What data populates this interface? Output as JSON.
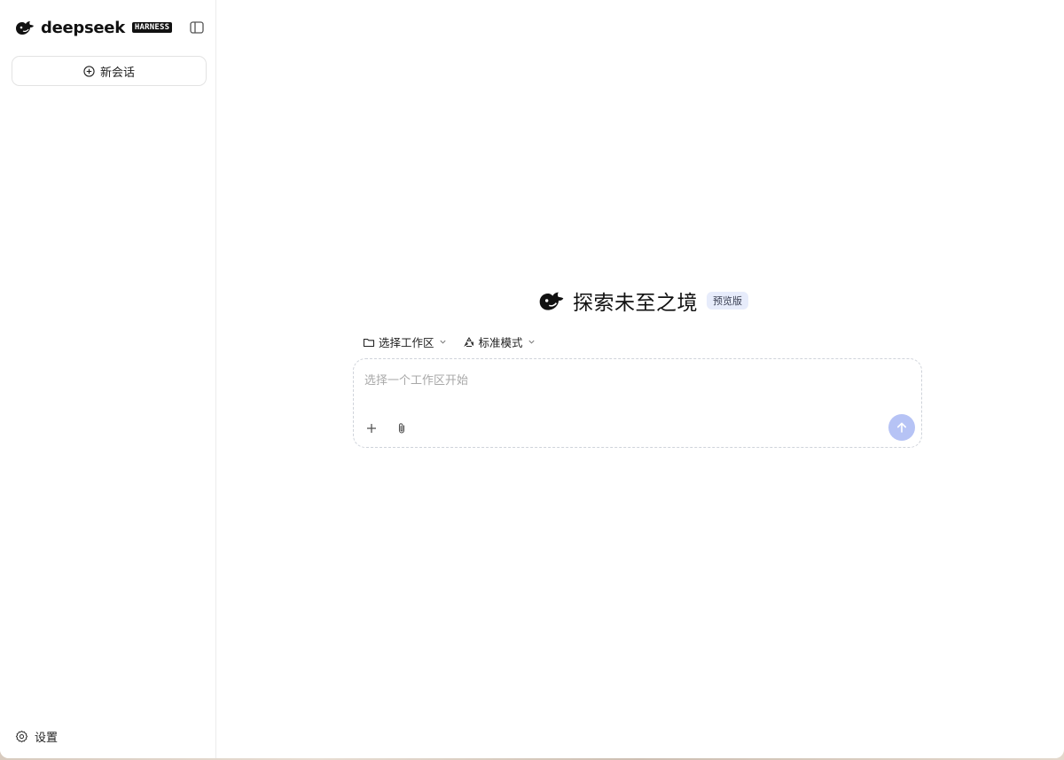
{
  "sidebar": {
    "brand": {
      "wordmark": "deepseek",
      "tag": "HARNESS"
    },
    "new_chat_label": "新会话",
    "settings_label": "设置"
  },
  "main": {
    "hero_title": "探索未至之境",
    "hero_badge": "预览版",
    "toolbar": {
      "workspace_label": "选择工作区",
      "mode_label": "标准模式"
    },
    "composer": {
      "placeholder": "选择一个工作区开始"
    }
  },
  "colors": {
    "brand_dark": "#111111",
    "send_button_disabled": "#b6c3f5",
    "badge_bg": "#e7ecfb"
  }
}
